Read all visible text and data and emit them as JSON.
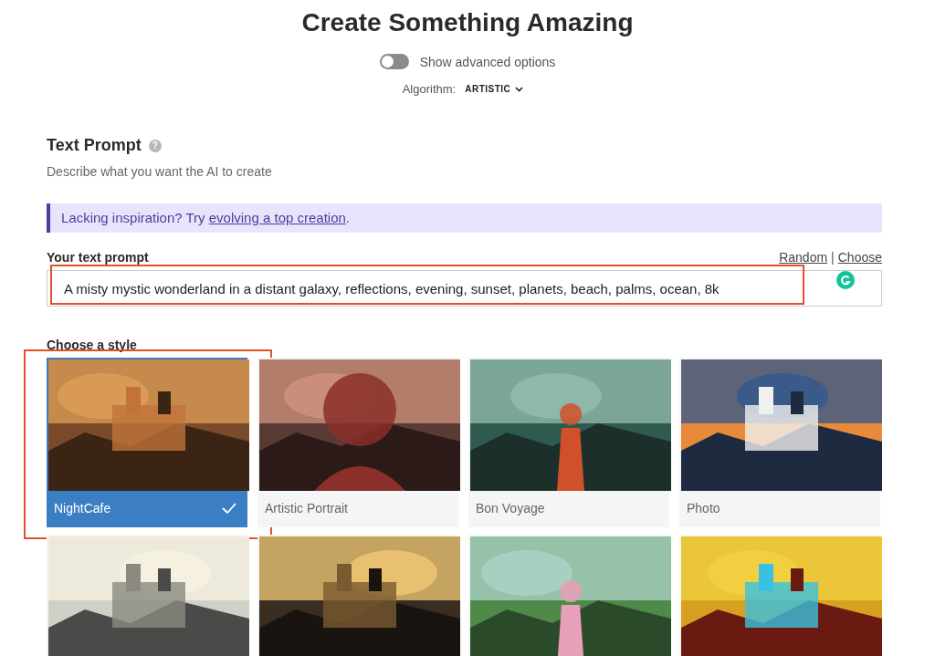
{
  "title": "Create Something Amazing",
  "advanced_toggle": {
    "label": "Show advanced options",
    "on": false
  },
  "algorithm": {
    "label": "Algorithm:",
    "value": "ARTISTIC"
  },
  "text_prompt": {
    "heading": "Text Prompt",
    "help": "?",
    "description": "Describe what you want the AI to create"
  },
  "inspiration": {
    "text": "Lacking inspiration? Try ",
    "link": "evolving a top creation",
    "end": "."
  },
  "prompt_field": {
    "label": "Your text prompt",
    "links": [
      "Random",
      "Choose"
    ],
    "separator": "|",
    "value": "A misty mystic wonderland in a distant galaxy, reflections, evening, sunset, planets, beach, palms, ocean, 8k",
    "highlighted": true
  },
  "styles": {
    "heading": "Choose a style",
    "items": [
      {
        "kind": "picture",
        "label": "NightCafe",
        "selected": true,
        "highlighted": true
      },
      {
        "kind": "picture",
        "label": "Artistic Portrait",
        "selected": false,
        "highlighted": false
      },
      {
        "kind": "picture",
        "label": "Bon Voyage",
        "selected": false,
        "highlighted": false
      },
      {
        "kind": "picture",
        "label": "Photo",
        "selected": false,
        "highlighted": false
      },
      {
        "kind": "picture",
        "selected": false,
        "highlighted": false
      },
      {
        "kind": "picture",
        "selected": false,
        "highlighted": false
      },
      {
        "kind": "picture",
        "selected": false,
        "highlighted": false
      },
      {
        "kind": "picture",
        "selected": false,
        "highlighted": false
      }
    ]
  }
}
